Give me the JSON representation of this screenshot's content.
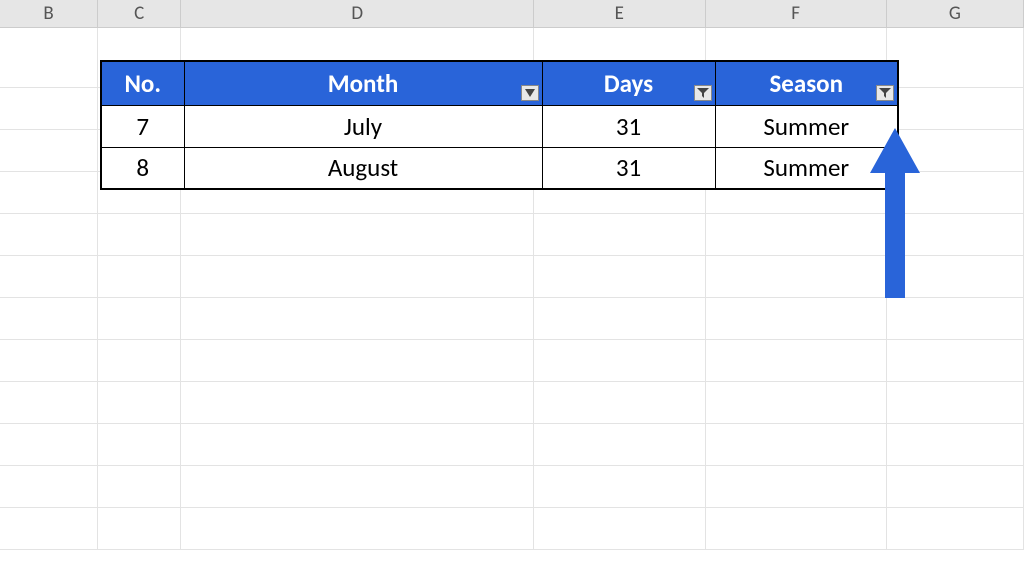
{
  "columns": {
    "b": "B",
    "c": "C",
    "d": "D",
    "e": "E",
    "f": "F",
    "g": "G"
  },
  "table": {
    "headers": {
      "no": "No.",
      "month": "Month",
      "days": "Days",
      "season": "Season"
    },
    "filter_state": {
      "month": "dropdown",
      "days": "filtered",
      "season": "filtered"
    },
    "rows": [
      {
        "no": "7",
        "month": "July",
        "days": "31",
        "season": "Summer"
      },
      {
        "no": "8",
        "month": "August",
        "days": "31",
        "season": "Summer"
      }
    ]
  },
  "colors": {
    "header_bg": "#2964d9",
    "arrow": "#2964d9"
  }
}
